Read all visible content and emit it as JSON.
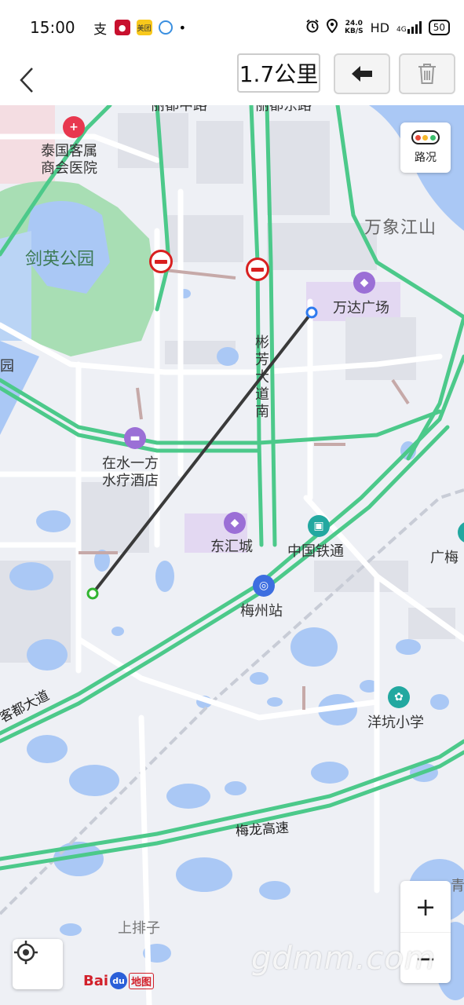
{
  "status_bar": {
    "time": "15:00",
    "net_speed_value": "24.0",
    "net_speed_unit": "KB/S",
    "hd": "HD",
    "signal": "4G",
    "battery": "50",
    "left_icons": [
      "alipay-icon",
      "app-icon",
      "meituan-icon",
      "app-icon",
      "dot-icon"
    ],
    "meituan_label": "美团"
  },
  "toolbar": {
    "distance": "1.7公里",
    "icons": {
      "back": "chevron-left-icon",
      "undo": "arrow-left-icon",
      "delete": "trash-icon"
    }
  },
  "map": {
    "labels": {
      "hospital": "泰国客属\n商会医院",
      "park": "剑英公园",
      "wanxiang": "万象江山",
      "wanda": "万达广场",
      "binfang": "彬芳大道南",
      "hotel": "在水一方\n水疗酒店",
      "donghui": "东汇城",
      "tietong": "中国铁通",
      "station": "梅州站",
      "guangmei": "广梅",
      "kedu": "客都大道",
      "yangkeng": "洋坑小学",
      "meilong": "梅龙高速",
      "shangpaizi": "上排子",
      "top_road_left": "丽都中路",
      "top_road_right": "丽都东路",
      "left_edge": "花园",
      "right_edge_bottom": "青高"
    },
    "traffic_button_label": "路况",
    "zoom_in": "+",
    "zoom_out": "−",
    "logo_bai": "Bai",
    "logo_du": "du",
    "logo_map": "地图",
    "watermark": "gdmm.com",
    "colors": {
      "road_green": "#4cc98a",
      "water": "#aac8f5",
      "park_green": "#a8deb4",
      "measure_line": "#3a3a3a",
      "start_point": "#31b531",
      "end_point": "#2f7bef",
      "pin_purple": "#9b6fd6",
      "pin_teal": "#22a8a0",
      "pin_red": "#e8384f",
      "pin_blue": "#3d6ee0"
    }
  }
}
